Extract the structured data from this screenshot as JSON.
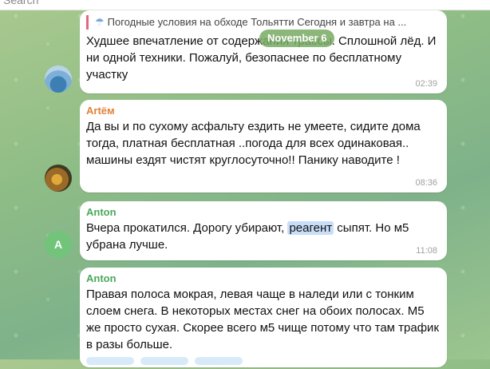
{
  "search": {
    "placeholder": "Search"
  },
  "date_divider": "November 6",
  "messages": [
    {
      "reply_snippet": "Погодные условия на обходе Тольятти Сегодня и завтра на ...",
      "text": "Худшее впечатление от содержания трассы. Сплошной лёд. И ни одной техники. Пожалуй, безопаснее по бесплатному участку",
      "time": "02:39"
    },
    {
      "sender": "Artём",
      "sender_color": "#e0823a",
      "text": "Да вы и по сухому асфальту ездить не умеете, сидите дома тогда, платная бесплатная ..погода для всех одинаковая.. машины ездят чистят круглосуточно!! Панику наводите !",
      "time": "08:36"
    },
    {
      "sender": "Anton",
      "sender_color": "#4aa85a",
      "avatar_letter": "A",
      "text_before": "Вчера прокатился. Дорогу убирают, ",
      "text_highlight": "реагент",
      "text_after": " сыпят. Но м5 убрана лучше.",
      "time": "11:08"
    },
    {
      "sender": "Anton",
      "sender_color": "#4aa85a",
      "text": "Правая полоса мокрая, левая чаще в наледи или с тонким слоем снега. В некоторых местах снег на обоих полосах. М5 же просто сухая. Скорее всего м5 чище потому что там трафик в разы больше."
    }
  ],
  "icons": {
    "reply_icon": "weather-icon"
  }
}
